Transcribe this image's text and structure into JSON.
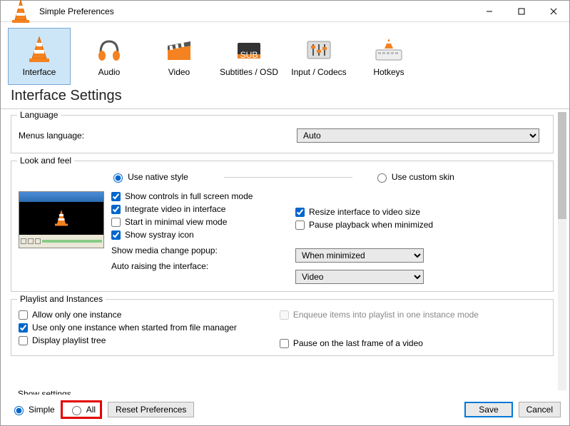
{
  "window": {
    "title": "Simple Preferences"
  },
  "tabs": {
    "interface": "Interface",
    "audio": "Audio",
    "video": "Video",
    "subtitles": "Subtitles / OSD",
    "input": "Input / Codecs",
    "hotkeys": "Hotkeys"
  },
  "heading": "Interface Settings",
  "language": {
    "group": "Language",
    "menus_label": "Menus language:",
    "value": "Auto"
  },
  "lookfeel": {
    "group": "Look and feel",
    "use_native": "Use native style",
    "use_custom": "Use custom skin",
    "show_controls_fs": "Show controls in full screen mode",
    "integrate_video": "Integrate video in interface",
    "resize_to_video": "Resize interface to video size",
    "start_minimal": "Start in minimal view mode",
    "pause_minimized": "Pause playback when minimized",
    "systray": "Show systray icon",
    "media_change_label": "Show media change popup:",
    "media_change_value": "When minimized",
    "auto_raise_label": "Auto raising the interface:",
    "auto_raise_value": "Video"
  },
  "playlist": {
    "group": "Playlist and Instances",
    "one_instance": "Allow only one instance",
    "enqueue": "Enqueue items into playlist in one instance mode",
    "one_instance_fm": "Use only one instance when started from file manager",
    "display_tree": "Display playlist tree",
    "pause_last_frame": "Pause on the last frame of a video"
  },
  "showsettings": {
    "group": "Show settings",
    "simple": "Simple",
    "all": "All"
  },
  "buttons": {
    "reset": "Reset Preferences",
    "save": "Save",
    "cancel": "Cancel"
  }
}
